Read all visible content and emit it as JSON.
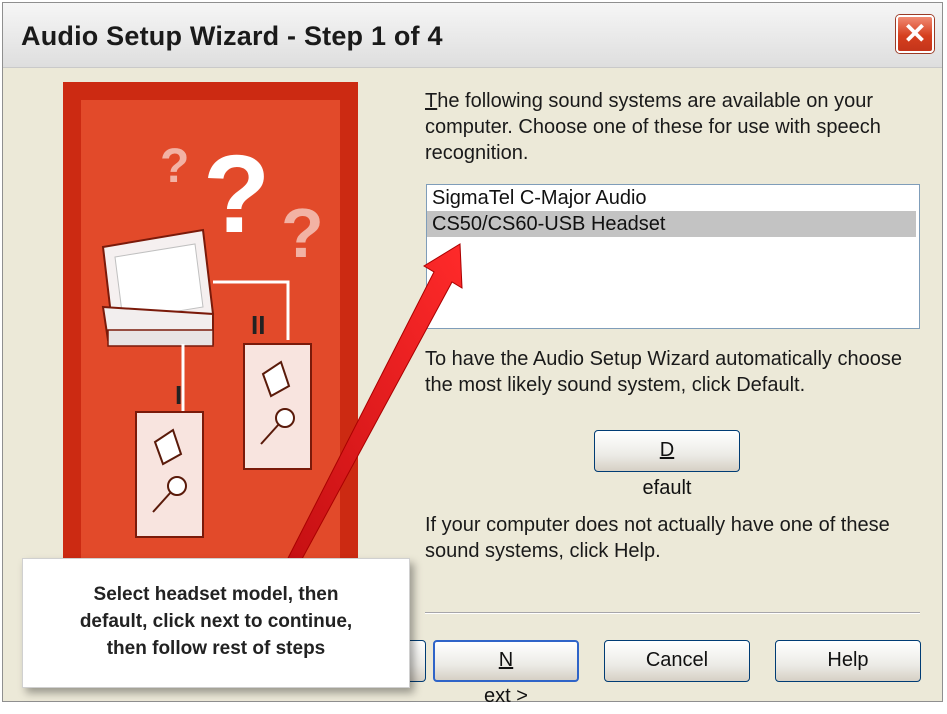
{
  "window": {
    "title": "Audio Setup Wizard - Step 1 of 4",
    "close_glyph": "✕"
  },
  "intro": {
    "first_letter": "T",
    "rest": "he following sound systems are available on your computer. Choose one of these for use with speech recognition."
  },
  "sound_systems": [
    {
      "label": "SigmaTel C-Major Audio",
      "selected": false
    },
    {
      "label": "CS50/CS60-USB Headset",
      "selected": true
    }
  ],
  "default_text": "To have the Audio Setup Wizard automatically choose the most likely sound system, click Default.",
  "buttons": {
    "default_mnemonic": "D",
    "default_rest": "efault",
    "next_mnemonic": "N",
    "next_rest": "ext >",
    "cancel": "Cancel",
    "help": "Help"
  },
  "help_text": "If your computer does not actually have one of these sound systems, click Help.",
  "callout": {
    "lines": [
      "Select headset model, then",
      "default, click next to continue,",
      "then follow rest of steps"
    ]
  },
  "colors": {
    "illustration_red": "#cc2a12",
    "arrow_red": "#e8171b",
    "selection_gray": "#c3c3c3"
  }
}
